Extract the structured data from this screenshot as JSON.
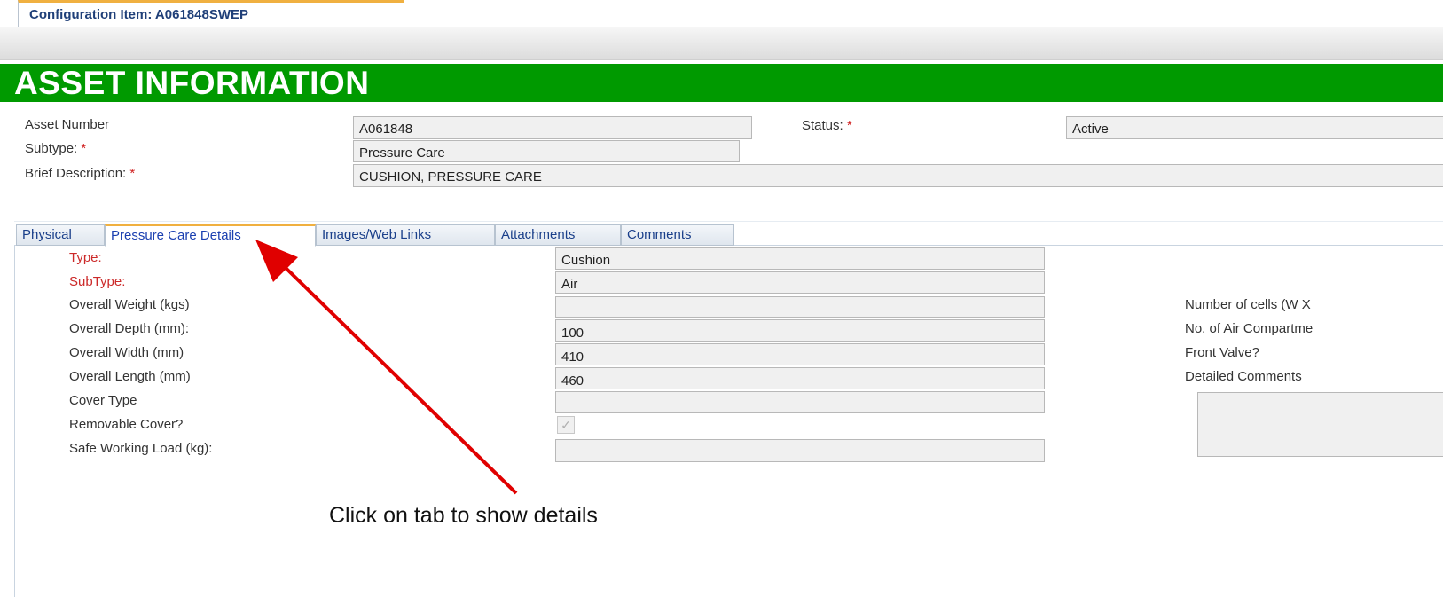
{
  "top_tab": {
    "label": "Configuration Item: A061848SWEP"
  },
  "header": {
    "title": "ASSET INFORMATION"
  },
  "asset": {
    "asset_number_label": "Asset Number",
    "asset_number": "A061848",
    "status_label": "Status:",
    "status": "Active",
    "subtype_label": "Subtype:",
    "subtype": "Pressure Care",
    "brief_label": "Brief Description:",
    "brief": "CUSHION, PRESSURE CARE",
    "required_mark": "*"
  },
  "tabs": [
    {
      "label": "Physical"
    },
    {
      "label": "Pressure Care Details"
    },
    {
      "label": "Images/Web Links"
    },
    {
      "label": "Attachments"
    },
    {
      "label": "Comments"
    }
  ],
  "details": {
    "type_label": "Type:",
    "type_value": "Cushion",
    "subtype_label": "SubType:",
    "subtype_value": "Air",
    "weight_label": "Overall Weight (kgs)",
    "weight_value": "",
    "depth_label": "Overall Depth (mm):",
    "depth_value": "100",
    "width_label": "Overall Width (mm)",
    "width_value": "410",
    "length_label": "Overall Length (mm)",
    "length_value": "460",
    "cover_label": "Cover Type",
    "cover_value": "",
    "removable_label": "Removable Cover?",
    "removable_checked": true,
    "removable_glyph": "✓",
    "swl_label": "Safe Working Load (kg):",
    "swl_value": "",
    "cells_label": "Number of cells (W X",
    "air_label": "No. of Air Compartme",
    "valve_label": "Front Valve?",
    "comments_label": "Detailed Comments"
  },
  "annotation": {
    "text": "Click on tab to show details",
    "arrow_color": "#e00000"
  }
}
